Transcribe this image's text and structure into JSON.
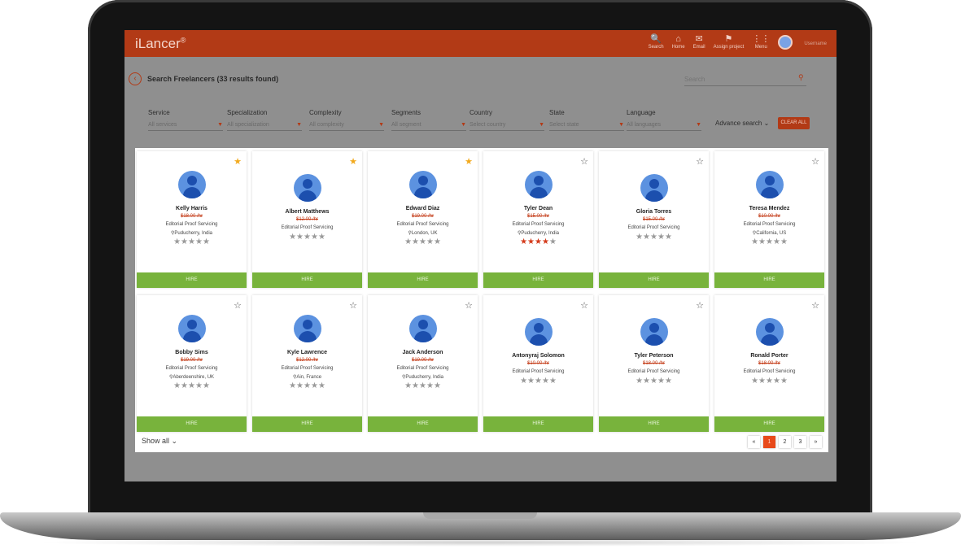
{
  "app": {
    "logo": "iLancer",
    "logo_mark": "®",
    "nav": [
      {
        "label": "Search",
        "icon": "search-icon",
        "glyph": "🔍"
      },
      {
        "label": "Home",
        "icon": "home-icon",
        "glyph": "⌂"
      },
      {
        "label": "Email",
        "icon": "mail-icon",
        "glyph": "✉"
      },
      {
        "label": "Assign project",
        "icon": "org-chart-icon",
        "glyph": "⚑"
      },
      {
        "label": "Menu",
        "icon": "grid-icon",
        "glyph": "⋮⋮"
      }
    ],
    "username": "Username"
  },
  "search": {
    "title": "Search Freelancers (33 results found)",
    "placeholder": "Search"
  },
  "filters": [
    {
      "label": "Service",
      "value": "All services"
    },
    {
      "label": "Specialization",
      "value": "All specialization"
    },
    {
      "label": "Complexity",
      "value": "All complexity"
    },
    {
      "label": "Segments",
      "value": "All segment"
    },
    {
      "label": "Country",
      "value": "Select country"
    },
    {
      "label": "State",
      "value": "Select state"
    },
    {
      "label": "Language",
      "value": "All languages"
    }
  ],
  "advance_search": "Advance search",
  "clear_all": "CLEAR ALL",
  "hire_label": "HIRE",
  "freelancers": [
    {
      "name": "Kelly Harris",
      "rate": "$18.00 /hr",
      "service": "Editorial Proof Servicing",
      "location": "Puducherry, India",
      "rating": 0,
      "favorite": true
    },
    {
      "name": "Albert Matthews",
      "rate": "$12.00 /hr",
      "service": "Editorial Proof Servicing",
      "location": "",
      "rating": 0,
      "favorite": true
    },
    {
      "name": "Edward Diaz",
      "rate": "$19.00 /hr",
      "service": "Editorial Proof Servicing",
      "location": "London, UK",
      "rating": 0,
      "favorite": true
    },
    {
      "name": "Tyler Dean",
      "rate": "$15.00 /hr",
      "service": "Editorial Proof Servicing",
      "location": "Puducherry, India",
      "rating": 4,
      "favorite": false
    },
    {
      "name": "Gloria Torres",
      "rate": "$15.00 /hr",
      "service": "Editorial Proof Servicing",
      "location": "",
      "rating": 0,
      "favorite": false
    },
    {
      "name": "Teresa Mendez",
      "rate": "$10.00 /hr",
      "service": "Editorial Proof Servicing",
      "location": "California, US",
      "rating": 0,
      "favorite": false
    },
    {
      "name": "Bobby Sims",
      "rate": "$19.00 /hr",
      "service": "Editorial Proof Servicing",
      "location": "Aberdeenshire, UK",
      "rating": 0,
      "favorite": false
    },
    {
      "name": "Kyle Lawrence",
      "rate": "$12.00 /hr",
      "service": "Editorial Proof Servicing",
      "location": "Ain, France",
      "rating": 0,
      "favorite": false
    },
    {
      "name": "Jack Anderson",
      "rate": "$19.00 /hr",
      "service": "Editorial Proof Servicing",
      "location": "Puducherry, India",
      "rating": 0,
      "favorite": false
    },
    {
      "name": "Antonyraj Solomon",
      "rate": "$10.00 /hr",
      "service": "Editorial Proof Servicing",
      "location": "",
      "rating": 0,
      "favorite": false
    },
    {
      "name": "Tyler Peterson",
      "rate": "$18.00 /hr",
      "service": "Editorial Proof Servicing",
      "location": "",
      "rating": 0,
      "favorite": false
    },
    {
      "name": "Ronald Porter",
      "rate": "$18.00 /hr",
      "service": "Editorial Proof Servicing",
      "location": "",
      "rating": 0,
      "favorite": false
    }
  ],
  "show_all": "Show all",
  "pagination": {
    "prev": "«",
    "pages": [
      "1",
      "2",
      "3"
    ],
    "current": "1",
    "next": "»"
  }
}
